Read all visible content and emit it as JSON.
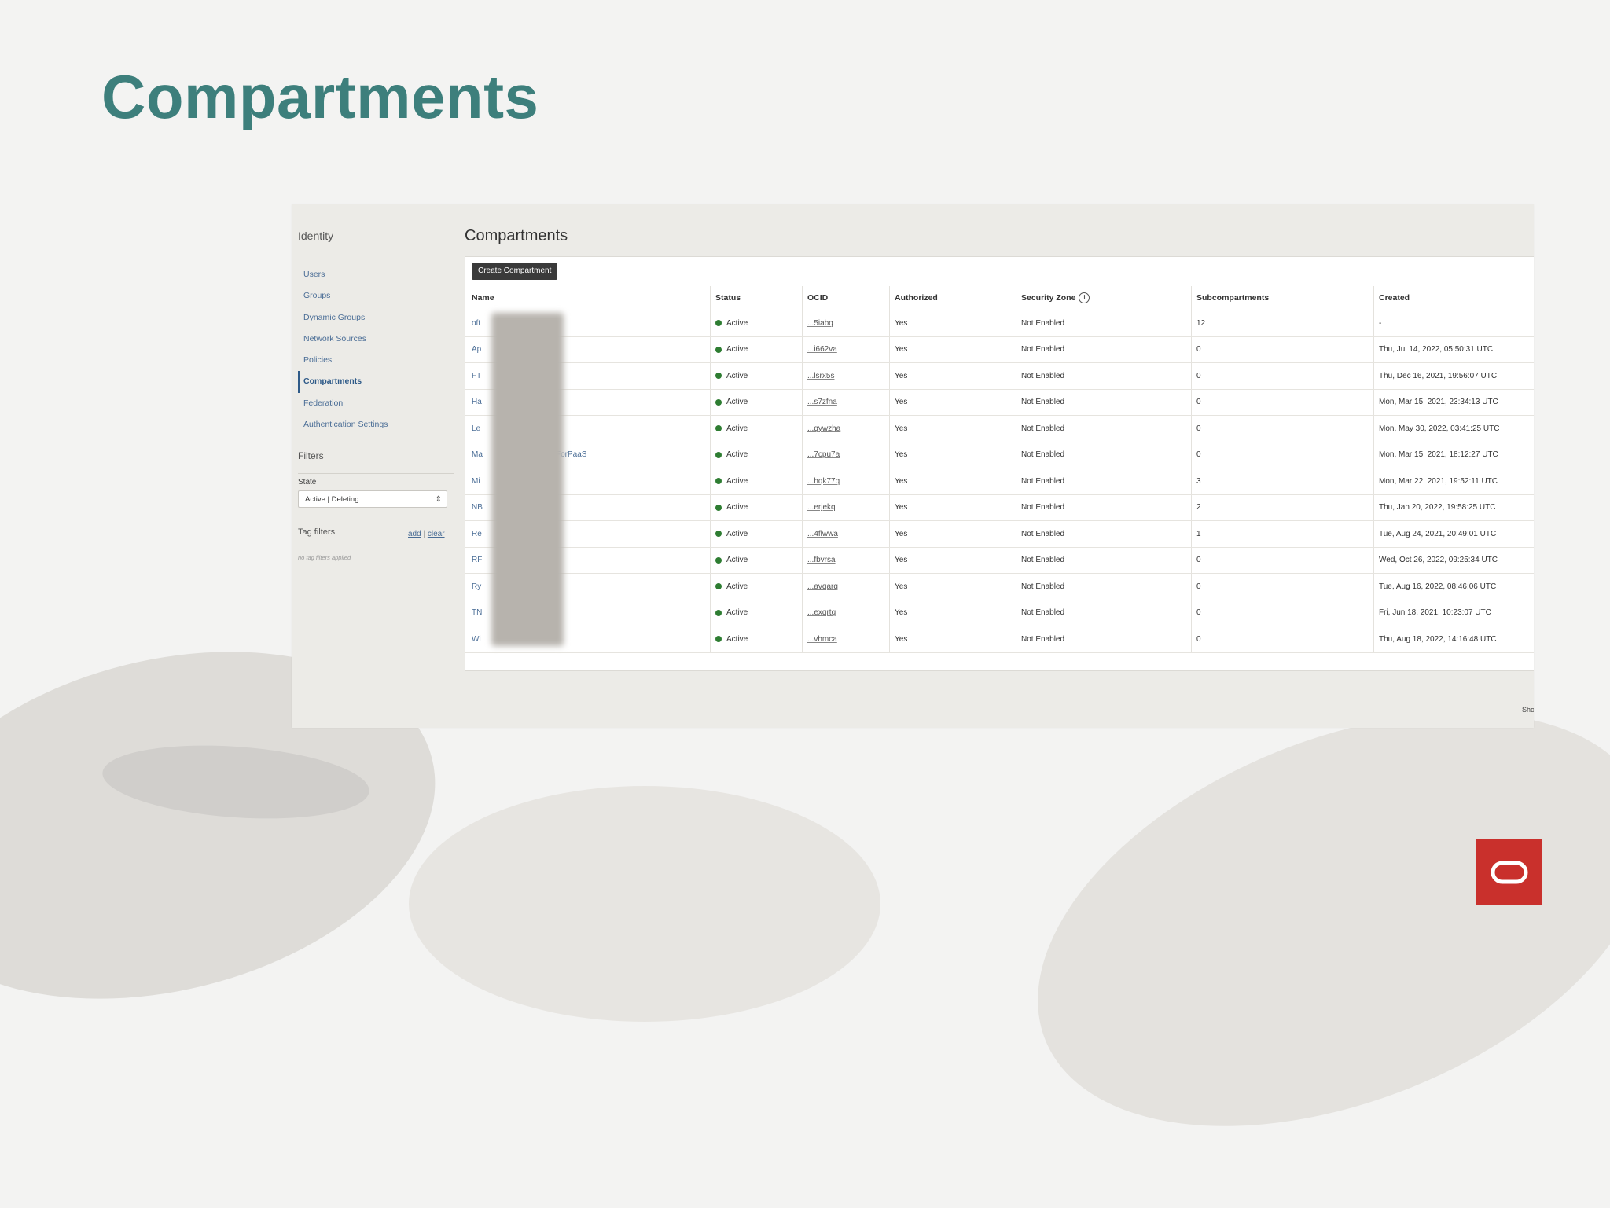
{
  "slide": {
    "title": "Compartments"
  },
  "sidebar": {
    "title": "Identity",
    "items": [
      {
        "label": "Users"
      },
      {
        "label": "Groups"
      },
      {
        "label": "Dynamic Groups"
      },
      {
        "label": "Network Sources"
      },
      {
        "label": "Policies"
      },
      {
        "label": "Compartments",
        "active": true
      },
      {
        "label": "Federation"
      },
      {
        "label": "Authentication Settings"
      }
    ],
    "filters_title": "Filters",
    "state_label": "State",
    "state_value": "Active | Deleting",
    "tag_filters_label": "Tag filters",
    "tag_add": "add",
    "tag_sep": "|",
    "tag_clear": "clear",
    "tag_note": "no tag filters applied"
  },
  "main": {
    "title": "Compartments",
    "create_button": "Create Compartment",
    "columns": [
      "Name",
      "Status",
      "OCID",
      "Authorized",
      "Security Zone",
      "Subcompartments",
      "Created"
    ],
    "rows": [
      {
        "name": "oft",
        "status": "Active",
        "ocid": "...5iabq",
        "authorized": "Yes",
        "zone": "Not Enabled",
        "sub": "12",
        "created": "-"
      },
      {
        "name": "Ap",
        "status": "Active",
        "ocid": "...i662va",
        "authorized": "Yes",
        "zone": "Not Enabled",
        "sub": "0",
        "created": "Thu, Jul 14, 2022, 05:50:31 UTC"
      },
      {
        "name": "FT",
        "status": "Active",
        "ocid": "...lsrx5s",
        "authorized": "Yes",
        "zone": "Not Enabled",
        "sub": "0",
        "created": "Thu, Dec 16, 2021, 19:56:07 UTC"
      },
      {
        "name": "Ha",
        "status": "Active",
        "ocid": "...s7zfna",
        "authorized": "Yes",
        "zone": "Not Enabled",
        "sub": "0",
        "created": "Mon, Mar 15, 2021, 23:34:13 UTC"
      },
      {
        "name": "Le",
        "status": "Active",
        "ocid": "...qywzha",
        "authorized": "Yes",
        "zone": "Not Enabled",
        "sub": "0",
        "created": "Mon, May 30, 2022, 03:41:25 UTC"
      },
      {
        "name": "Ma",
        "name_tail": "ForPaaS",
        "status": "Active",
        "ocid": "...7cpu7a",
        "authorized": "Yes",
        "zone": "Not Enabled",
        "sub": "0",
        "created": "Mon, Mar 15, 2021, 18:12:27 UTC"
      },
      {
        "name": "Mi",
        "status": "Active",
        "ocid": "...hqk77q",
        "authorized": "Yes",
        "zone": "Not Enabled",
        "sub": "3",
        "created": "Mon, Mar 22, 2021, 19:52:11 UTC"
      },
      {
        "name": "NB",
        "status": "Active",
        "ocid": "...erjekq",
        "authorized": "Yes",
        "zone": "Not Enabled",
        "sub": "2",
        "created": "Thu, Jan 20, 2022, 19:58:25 UTC"
      },
      {
        "name": "Re",
        "status": "Active",
        "ocid": "...4flwwa",
        "authorized": "Yes",
        "zone": "Not Enabled",
        "sub": "1",
        "created": "Tue, Aug 24, 2021, 20:49:01 UTC"
      },
      {
        "name": "RF",
        "status": "Active",
        "ocid": "...fbvrsa",
        "authorized": "Yes",
        "zone": "Not Enabled",
        "sub": "0",
        "created": "Wed, Oct 26, 2022, 09:25:34 UTC"
      },
      {
        "name": "Ry",
        "status": "Active",
        "ocid": "...avqarq",
        "authorized": "Yes",
        "zone": "Not Enabled",
        "sub": "0",
        "created": "Tue, Aug 16, 2022, 08:46:06 UTC"
      },
      {
        "name": "TN",
        "status": "Active",
        "ocid": "...exqrtq",
        "authorized": "Yes",
        "zone": "Not Enabled",
        "sub": "0",
        "created": "Fri, Jun 18, 2021, 10:23:07 UTC"
      },
      {
        "name": "Wi",
        "status": "Active",
        "ocid": "...vhmca",
        "authorized": "Yes",
        "zone": "Not Enabled",
        "sub": "0",
        "created": "Thu, Aug 18, 2022, 14:16:48 UTC"
      }
    ],
    "show_text": "Sho"
  },
  "colors": {
    "title": "#3d7f7c",
    "active_status": "#2e7d32",
    "logo": "#c9302c"
  },
  "logo_icon": "oracle-logo-icon"
}
